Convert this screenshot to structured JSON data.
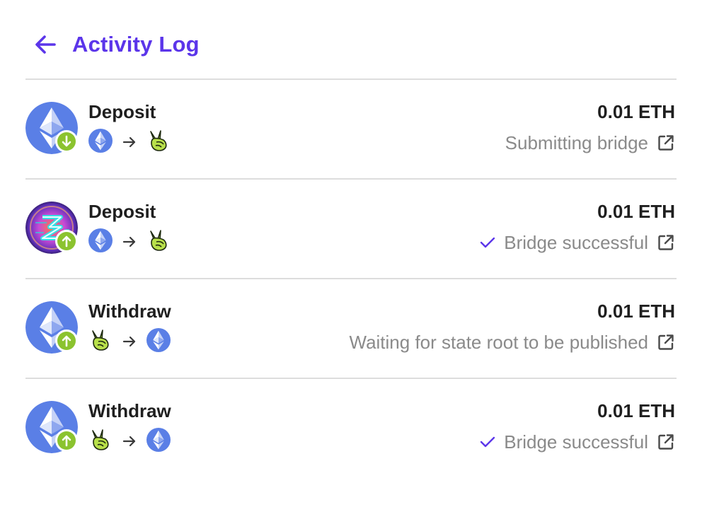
{
  "header": {
    "title": "Activity Log"
  },
  "colors": {
    "accent": "#5b35ea",
    "eth_blue": "#5a7fe6",
    "badge_green": "#8bc32f",
    "status_gray": "#8a8a8a",
    "divider": "#dddddd"
  },
  "rows": [
    {
      "type": "Deposit",
      "amount": "0.01 ETH",
      "status": "Submitting bridge",
      "status_check": false,
      "avatar_icon": "ethereum-icon",
      "badge_icon": "arrow-down-icon",
      "route_from": "ethereum-icon",
      "route_to": "peace-hand-icon"
    },
    {
      "type": "Deposit",
      "amount": "0.01 ETH",
      "status": "Bridge successful",
      "status_check": true,
      "avatar_icon": "token-logo-icon",
      "badge_icon": "arrow-up-icon",
      "route_from": "ethereum-icon",
      "route_to": "peace-hand-icon"
    },
    {
      "type": "Withdraw",
      "amount": "0.01 ETH",
      "status": "Waiting for state root to be published",
      "status_check": false,
      "avatar_icon": "ethereum-icon",
      "badge_icon": "arrow-up-icon",
      "route_from": "peace-hand-icon",
      "route_to": "ethereum-icon"
    },
    {
      "type": "Withdraw",
      "amount": "0.01 ETH",
      "status": "Bridge successful",
      "status_check": true,
      "avatar_icon": "ethereum-icon",
      "badge_icon": "arrow-up-icon",
      "route_from": "peace-hand-icon",
      "route_to": "ethereum-icon"
    }
  ]
}
